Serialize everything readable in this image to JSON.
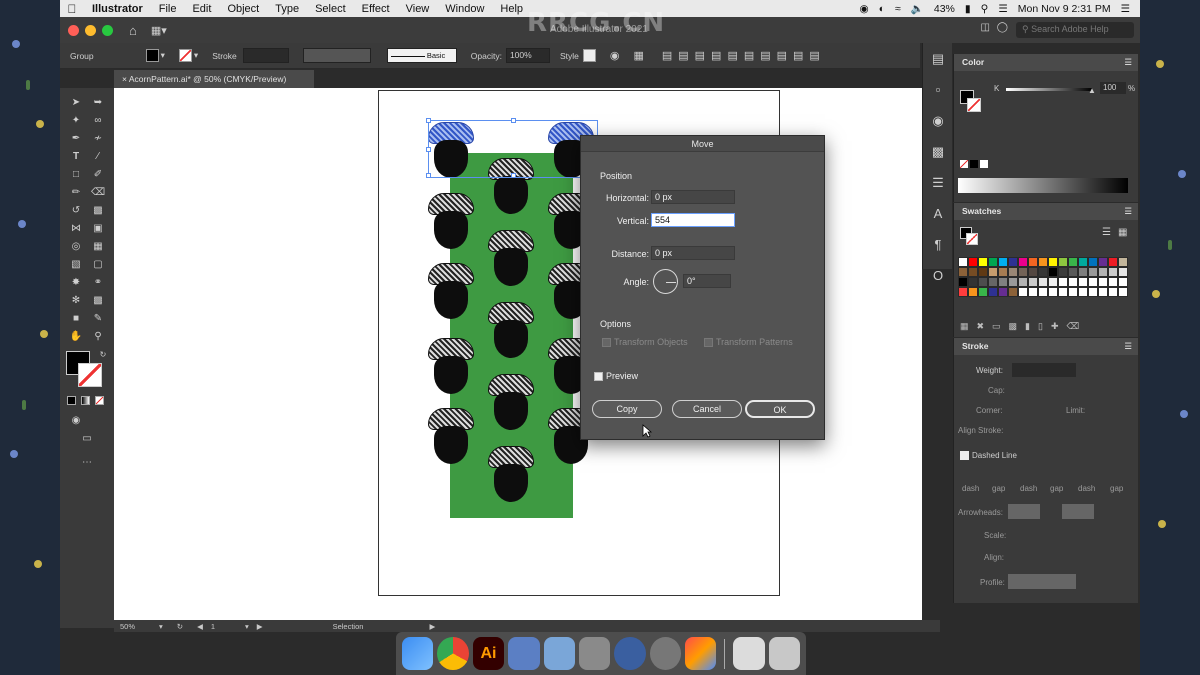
{
  "menubar": {
    "app": "Illustrator",
    "items": [
      "File",
      "Edit",
      "Object",
      "Type",
      "Select",
      "Effect",
      "View",
      "Window",
      "Help"
    ],
    "battery": "43%",
    "datetime": "Mon Nov 9  2:31 PM"
  },
  "appbar": {
    "title": "Adobe Illustrator 2021",
    "search_placeholder": "Search Adobe Help"
  },
  "controlbar": {
    "selection_label": "Group",
    "stroke_label": "Stroke",
    "brush_label": "Basic",
    "opacity_label": "Opacity:",
    "opacity_value": "100%",
    "style_label": "Style"
  },
  "document": {
    "tab_label": "AcornPattern.ai* @ 50% (CMYK/Preview)"
  },
  "statusbar": {
    "zoom": "50%",
    "artboard": "1",
    "tool": "Selection"
  },
  "color_panel": {
    "title": "Color",
    "channel": "K",
    "value": "100",
    "unit": "%"
  },
  "swatches_panel": {
    "title": "Swatches",
    "colors": [
      "#ffffff",
      "#ff0000",
      "#ffff00",
      "#00a651",
      "#00aeef",
      "#2e3192",
      "#ec008c",
      "#f26522",
      "#f7941d",
      "#fff200",
      "#8dc63f",
      "#39b54a",
      "#00a99d",
      "#0072bc",
      "#662d91",
      "#ed1c24",
      "#c2b59b",
      "#8c6239",
      "#754c24",
      "#603913",
      "#c69c6d",
      "#a67c52",
      "#998675",
      "#736357",
      "#534741",
      "#363636",
      "#000000",
      "#3c3c3c",
      "#595959",
      "#7f7f7f",
      "#999999",
      "#b3b3b3",
      "#cccccc",
      "#e6e6e6",
      "#000000",
      "#333333",
      "#4d4d4d",
      "#666666",
      "#808080",
      "#999999",
      "#b3b3b3",
      "#cccccc",
      "#e6e6e6",
      "#f2f2f2",
      "#ffffff",
      "#ffffff",
      "#ffffff",
      "#ffffff",
      "#ffffff",
      "#ffffff",
      "#ffffff",
      "#ff3d3d",
      "#f7941d",
      "#39b54a",
      "#2e3192",
      "#662d91",
      "#8c6239",
      "#ffffff",
      "#ffffff",
      "#ffffff",
      "#ffffff",
      "#ffffff",
      "#ffffff",
      "#ffffff",
      "#ffffff",
      "#ffffff",
      "#ffffff",
      "#ffffff"
    ]
  },
  "stroke_panel": {
    "title": "Stroke",
    "weight_label": "Weight:",
    "cap_label": "Cap:",
    "corner_label": "Corner:",
    "limit_label": "Limit:",
    "align_label": "Align Stroke:",
    "dashed_label": "Dashed Line",
    "dash_cols": [
      "dash",
      "gap",
      "dash",
      "gap",
      "dash",
      "gap"
    ],
    "arrowheads_label": "Arrowheads:",
    "scale_label": "Scale:",
    "align2_label": "Align:",
    "profile_label": "Profile:"
  },
  "dialog": {
    "title": "Move",
    "position_label": "Position",
    "horizontal_label": "Horizontal:",
    "horizontal_value": "0 px",
    "vertical_label": "Vertical:",
    "vertical_value": "554",
    "distance_label": "Distance:",
    "distance_value": "0 px",
    "angle_label": "Angle:",
    "angle_value": "0°",
    "options_label": "Options",
    "transform_objects_label": "Transform Objects",
    "transform_patterns_label": "Transform Patterns",
    "preview_label": "Preview",
    "copy_label": "Copy",
    "cancel_label": "Cancel",
    "ok_label": "OK"
  },
  "watermark": "RRCG.CN",
  "colors": {
    "artboard_fill": "#3e9a42",
    "selection": "#5b8ff0"
  }
}
